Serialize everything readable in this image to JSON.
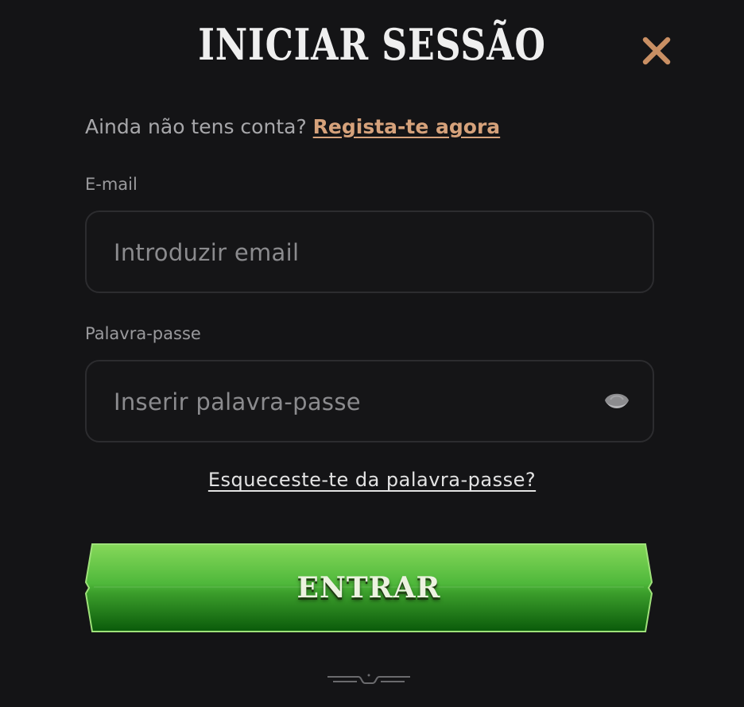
{
  "dialog": {
    "title": "INICIAR SESSÃO",
    "close_icon": "close-icon"
  },
  "signup": {
    "prompt": "Ainda não tens conta?",
    "link": "Regista-te agora"
  },
  "email": {
    "label": "E-mail",
    "placeholder": "Introduzir email",
    "value": ""
  },
  "password": {
    "label": "Palavra-passe",
    "placeholder": "Inserir palavra-passe",
    "value": "",
    "toggle_icon": "eye-icon"
  },
  "forgot_link": "Esqueceste-te da palavra-passe?",
  "submit_label": "ENTRAR",
  "colors": {
    "background": "#141416",
    "accent_link": "#d6a27b",
    "close": "#c98f63",
    "button_green": "#4fbf3a"
  }
}
